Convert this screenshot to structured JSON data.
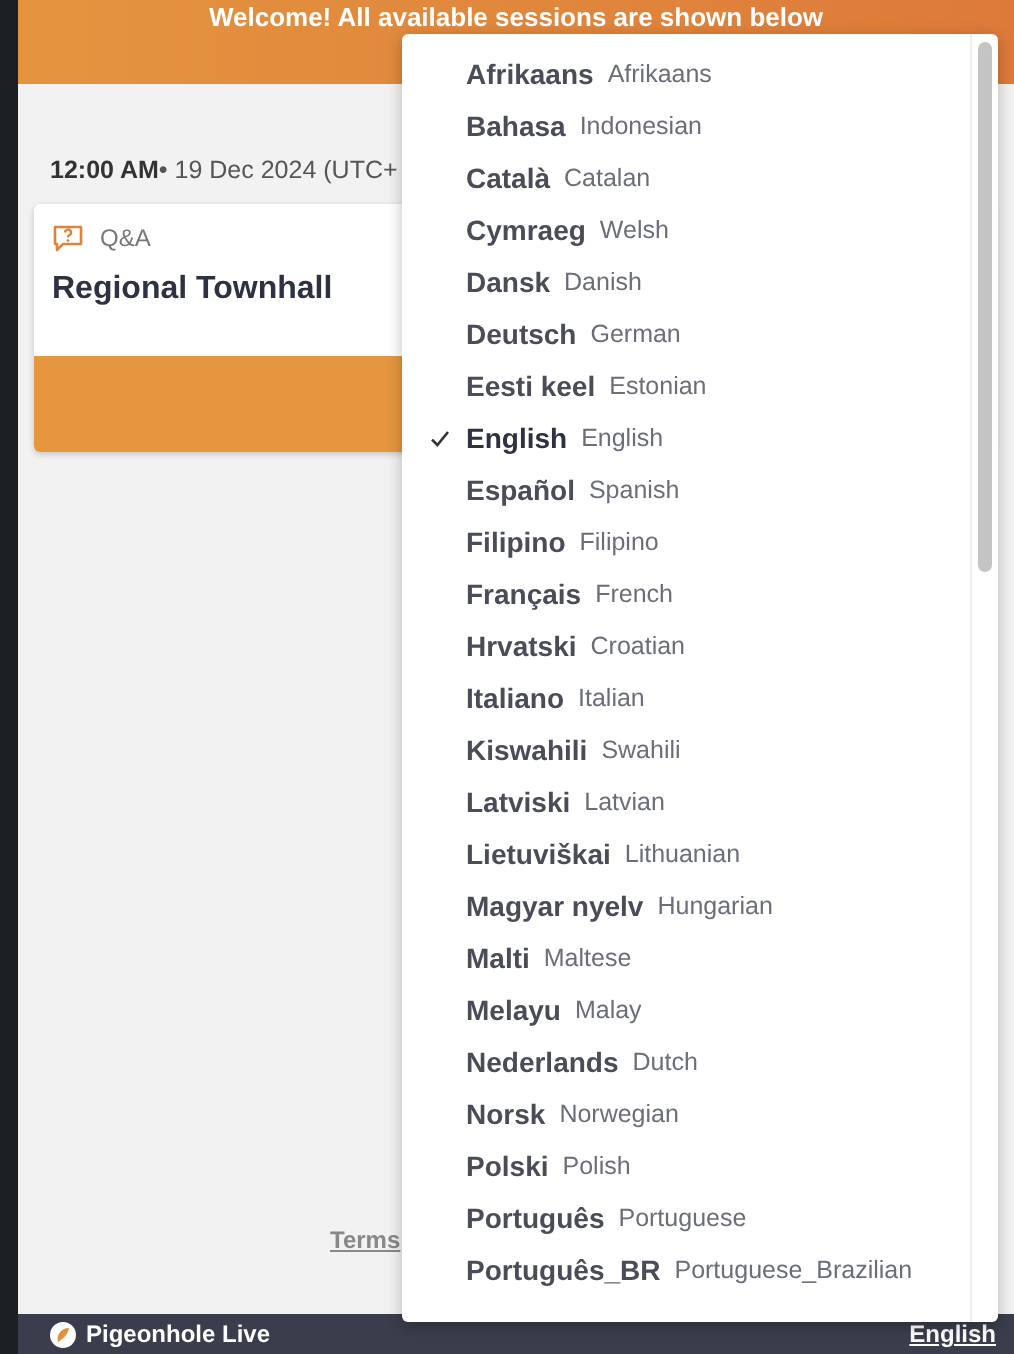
{
  "banner": {
    "text": "Welcome! All available sessions are shown below"
  },
  "session": {
    "time": "12:00 AM",
    "date": "• 19 Dec 2024 (UTC+",
    "type": "Q&A",
    "title": "Regional Townhall"
  },
  "footer": {
    "link": "Terms"
  },
  "bottom_bar": {
    "brand": "Pigeonhole Live",
    "language": "English"
  },
  "language_menu": [
    {
      "native": "Afrikaans",
      "english": "Afrikaans",
      "selected": false
    },
    {
      "native": "Bahasa",
      "english": "Indonesian",
      "selected": false
    },
    {
      "native": "Català",
      "english": "Catalan",
      "selected": false
    },
    {
      "native": "Cymraeg",
      "english": "Welsh",
      "selected": false
    },
    {
      "native": "Dansk",
      "english": "Danish",
      "selected": false
    },
    {
      "native": "Deutsch",
      "english": "German",
      "selected": false
    },
    {
      "native": "Eesti keel",
      "english": "Estonian",
      "selected": false
    },
    {
      "native": "English",
      "english": "English",
      "selected": true
    },
    {
      "native": "Español",
      "english": "Spanish",
      "selected": false
    },
    {
      "native": "Filipino",
      "english": "Filipino",
      "selected": false
    },
    {
      "native": "Français",
      "english": "French",
      "selected": false
    },
    {
      "native": "Hrvatski",
      "english": "Croatian",
      "selected": false
    },
    {
      "native": "Italiano",
      "english": "Italian",
      "selected": false
    },
    {
      "native": "Kiswahili",
      "english": "Swahili",
      "selected": false
    },
    {
      "native": "Latviski",
      "english": "Latvian",
      "selected": false
    },
    {
      "native": "Lietuviškai",
      "english": "Lithuanian",
      "selected": false
    },
    {
      "native": "Magyar nyelv",
      "english": "Hungarian",
      "selected": false
    },
    {
      "native": "Malti",
      "english": "Maltese",
      "selected": false
    },
    {
      "native": "Melayu",
      "english": "Malay",
      "selected": false
    },
    {
      "native": "Nederlands",
      "english": "Dutch",
      "selected": false
    },
    {
      "native": "Norsk",
      "english": "Norwegian",
      "selected": false
    },
    {
      "native": "Polski",
      "english": "Polish",
      "selected": false
    },
    {
      "native": "Português",
      "english": "Portuguese",
      "selected": false
    },
    {
      "native": "Português_BR",
      "english": "Portuguese_Brazilian",
      "selected": false
    }
  ]
}
